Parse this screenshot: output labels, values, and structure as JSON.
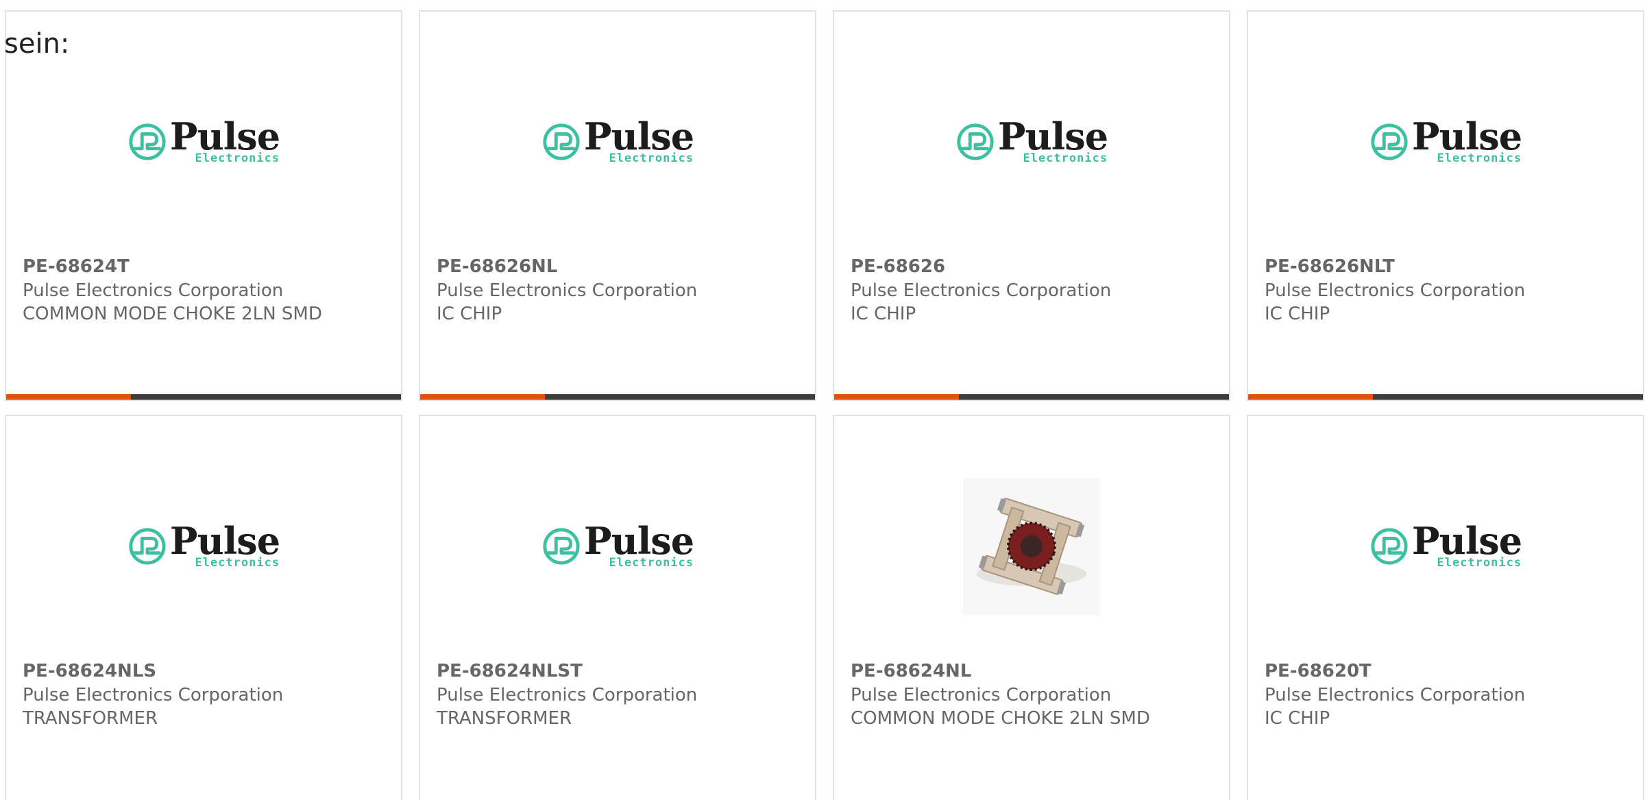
{
  "intro_text": "sein:",
  "colors": {
    "accent": "#e84d13",
    "bar": "#3d3d3d",
    "logo_teal": "#3dbfa0",
    "text": "#666666"
  },
  "products": [
    {
      "part": "PE-68624T",
      "manufacturer": "Pulse Electronics Corporation",
      "description": "COMMON MODE CHOKE 2LN SMD",
      "image": "pulse-logo",
      "logo_word": "Pulse",
      "logo_sub": "Electronics"
    },
    {
      "part": "PE-68626NL",
      "manufacturer": "Pulse Electronics Corporation",
      "description": "IC CHIP",
      "image": "pulse-logo",
      "logo_word": "Pulse",
      "logo_sub": "Electronics"
    },
    {
      "part": "PE-68626",
      "manufacturer": "Pulse Electronics Corporation",
      "description": "IC CHIP",
      "image": "pulse-logo",
      "logo_word": "Pulse",
      "logo_sub": "Electronics"
    },
    {
      "part": "PE-68626NLT",
      "manufacturer": "Pulse Electronics Corporation",
      "description": "IC CHIP",
      "image": "pulse-logo",
      "logo_word": "Pulse",
      "logo_sub": "Electronics"
    },
    {
      "part": "PE-68624NLS",
      "manufacturer": "Pulse Electronics Corporation",
      "description": "TRANSFORMER",
      "image": "pulse-logo",
      "logo_word": "Pulse",
      "logo_sub": "Electronics"
    },
    {
      "part": "PE-68624NLST",
      "manufacturer": "Pulse Electronics Corporation",
      "description": "TRANSFORMER",
      "image": "pulse-logo",
      "logo_word": "Pulse",
      "logo_sub": "Electronics"
    },
    {
      "part": "PE-68624NL",
      "manufacturer": "Pulse Electronics Corporation",
      "description": "COMMON MODE CHOKE 2LN SMD",
      "image": "choke-photo"
    },
    {
      "part": "PE-68620T",
      "manufacturer": "Pulse Electronics Corporation",
      "description": "IC CHIP",
      "image": "pulse-logo",
      "logo_word": "Pulse",
      "logo_sub": "Electronics"
    }
  ]
}
